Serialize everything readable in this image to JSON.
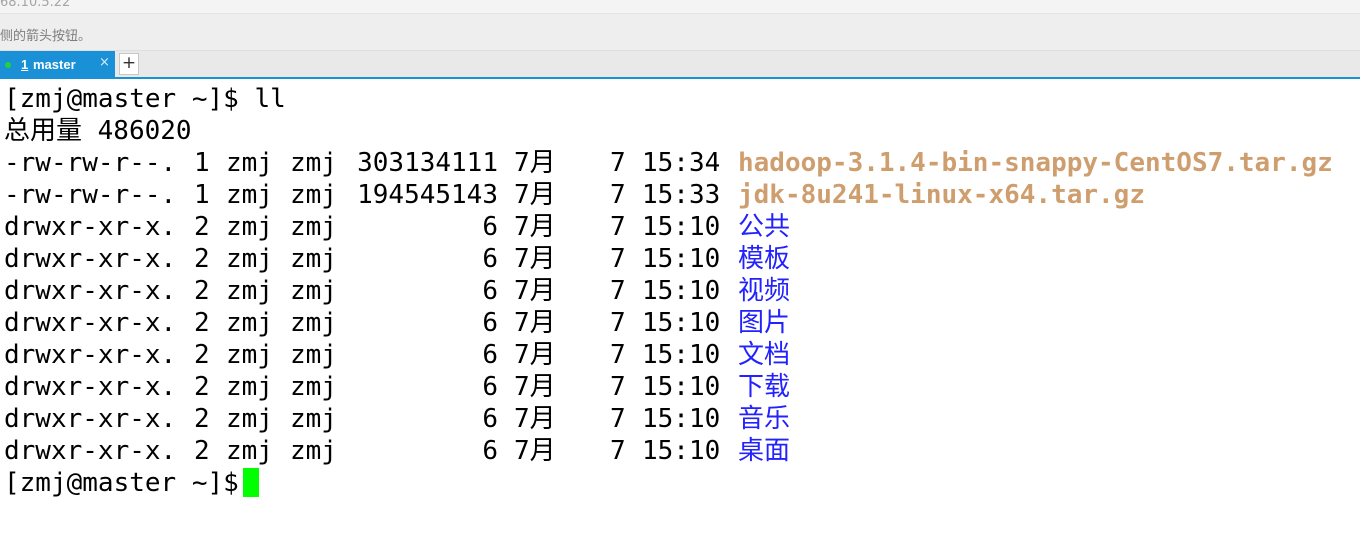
{
  "window": {
    "top_fragment": "68.10.5.22",
    "hint_text": "侧的箭头按钮。"
  },
  "tabs": [
    {
      "number": "1",
      "label": "master",
      "close_glyph": "×",
      "active": true
    }
  ],
  "new_tab_label": "+",
  "colors": {
    "tab_active": "#1a91d6",
    "status_dot": "#22d23a",
    "archive_name": "#cf9e6e",
    "directory_name": "#2222ff",
    "cursor": "#00ff00"
  },
  "terminal": {
    "prompt": "[zmj@master ~]$",
    "command": "ll",
    "total_line": "总用量 486020",
    "entries": [
      {
        "perms": "-rw-rw-r--.",
        "links": "1",
        "user": "zmj",
        "group": "zmj",
        "size": "303134111",
        "month": "7月",
        "day": "7",
        "time": "15:34",
        "name": "hadoop-3.1.4-bin-snappy-CentOS7.tar.gz",
        "type": "archive"
      },
      {
        "perms": "-rw-rw-r--.",
        "links": "1",
        "user": "zmj",
        "group": "zmj",
        "size": "194545143",
        "month": "7月",
        "day": "7",
        "time": "15:33",
        "name": "jdk-8u241-linux-x64.tar.gz",
        "type": "archive"
      },
      {
        "perms": "drwxr-xr-x.",
        "links": "2",
        "user": "zmj",
        "group": "zmj",
        "size": "6",
        "month": "7月",
        "day": "7",
        "time": "15:10",
        "name": "公共",
        "type": "dir"
      },
      {
        "perms": "drwxr-xr-x.",
        "links": "2",
        "user": "zmj",
        "group": "zmj",
        "size": "6",
        "month": "7月",
        "day": "7",
        "time": "15:10",
        "name": "模板",
        "type": "dir"
      },
      {
        "perms": "drwxr-xr-x.",
        "links": "2",
        "user": "zmj",
        "group": "zmj",
        "size": "6",
        "month": "7月",
        "day": "7",
        "time": "15:10",
        "name": "视频",
        "type": "dir"
      },
      {
        "perms": "drwxr-xr-x.",
        "links": "2",
        "user": "zmj",
        "group": "zmj",
        "size": "6",
        "month": "7月",
        "day": "7",
        "time": "15:10",
        "name": "图片",
        "type": "dir"
      },
      {
        "perms": "drwxr-xr-x.",
        "links": "2",
        "user": "zmj",
        "group": "zmj",
        "size": "6",
        "month": "7月",
        "day": "7",
        "time": "15:10",
        "name": "文档",
        "type": "dir"
      },
      {
        "perms": "drwxr-xr-x.",
        "links": "2",
        "user": "zmj",
        "group": "zmj",
        "size": "6",
        "month": "7月",
        "day": "7",
        "time": "15:10",
        "name": "下载",
        "type": "dir"
      },
      {
        "perms": "drwxr-xr-x.",
        "links": "2",
        "user": "zmj",
        "group": "zmj",
        "size": "6",
        "month": "7月",
        "day": "7",
        "time": "15:10",
        "name": "音乐",
        "type": "dir"
      },
      {
        "perms": "drwxr-xr-x.",
        "links": "2",
        "user": "zmj",
        "group": "zmj",
        "size": "6",
        "month": "7月",
        "day": "7",
        "time": "15:10",
        "name": "桌面",
        "type": "dir"
      }
    ]
  }
}
